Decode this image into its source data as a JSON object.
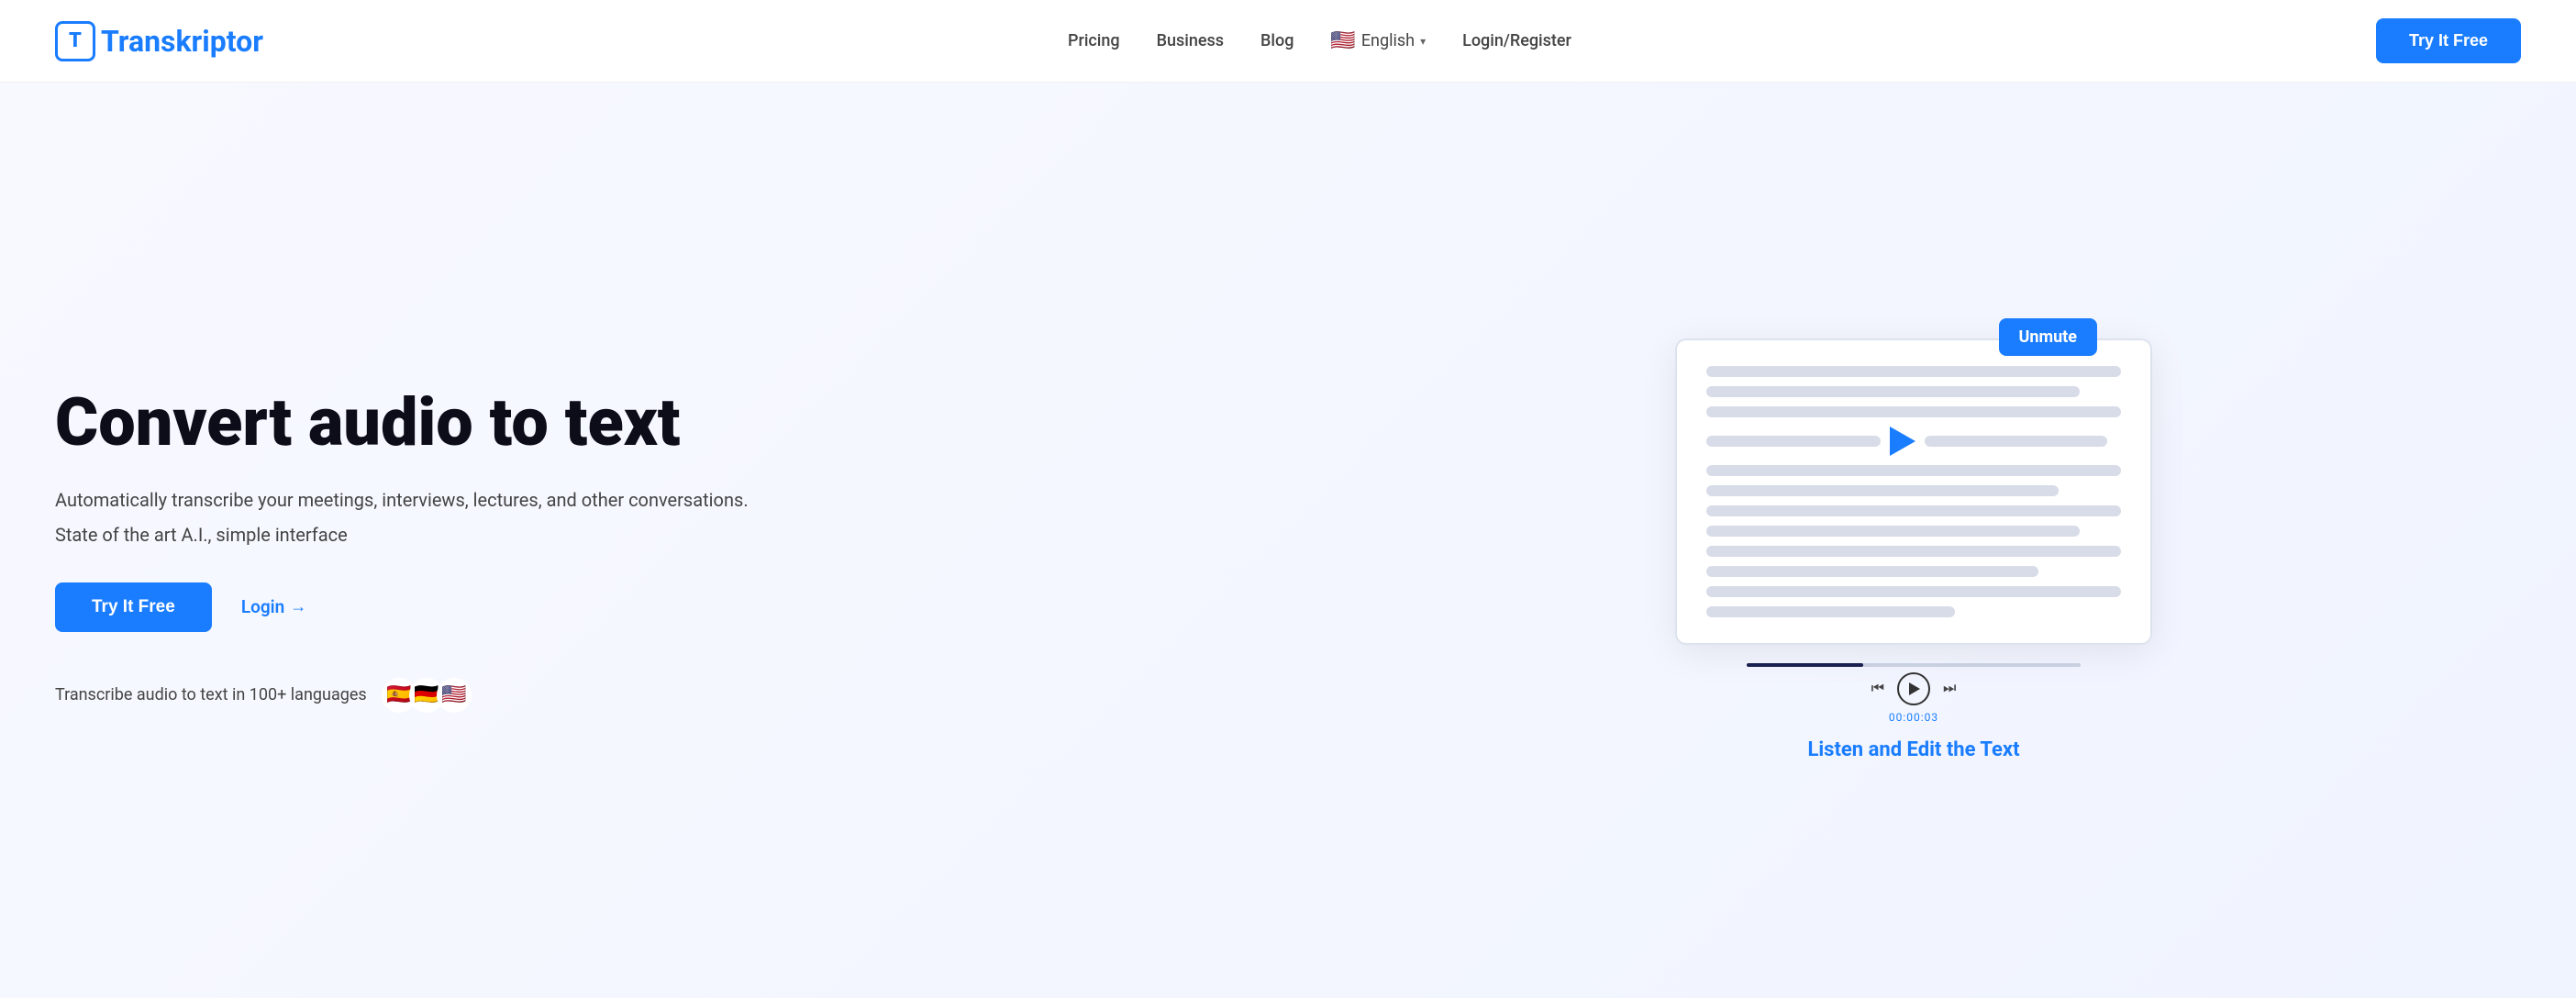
{
  "header": {
    "logo_letter": "T",
    "logo_name_prefix": "",
    "logo_name": "Transkriptor",
    "nav": {
      "pricing": "Pricing",
      "business": "Business",
      "blog": "Blog",
      "language": "English",
      "login_register": "Login/Register"
    },
    "cta_button": "Try It Free"
  },
  "hero": {
    "title": "Convert audio to text",
    "subtitle": "Automatically transcribe your meetings, interviews, lectures, and other conversations.",
    "tagline": "State of the art A.I., simple interface",
    "try_btn": "Try It Free",
    "login_link": "Login",
    "languages_text": "Transcribe audio to text in 100+ languages",
    "flags": [
      "🇪🇸",
      "🇩🇪",
      "🇺🇸"
    ],
    "unmute_label": "Unmute",
    "listen_edit_label": "Listen and Edit the Text",
    "timestamp": "00:00:03"
  }
}
